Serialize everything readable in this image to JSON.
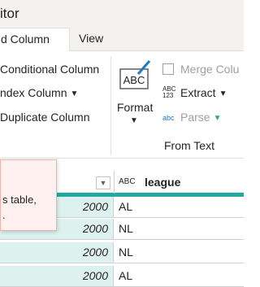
{
  "window": {
    "title": "itor"
  },
  "tabs": [
    {
      "label": "d Column",
      "active": true
    },
    {
      "label": "View",
      "active": false
    }
  ],
  "ribbon": {
    "left_items": [
      {
        "label": "Conditional Column"
      },
      {
        "label": "ndex Column"
      },
      {
        "label": "Duplicate Column"
      }
    ],
    "format": {
      "icon_text": "ABC",
      "label": "Format"
    },
    "text_items": [
      {
        "label": "Merge Colu",
        "disabled": true
      },
      {
        "label": "Extract",
        "disabled": false
      },
      {
        "label": "Parse",
        "disabled": true
      }
    ],
    "group_label": "From Text",
    "accent_color": "#22a9a2"
  },
  "tooltip": {
    "line1": "s table,",
    "line2": "."
  },
  "grid": {
    "column2": {
      "type_icon": "ABC",
      "header": "league"
    },
    "rows": [
      {
        "year": "2000",
        "league": "AL"
      },
      {
        "year": "2000",
        "league": "NL"
      },
      {
        "year": "2000",
        "league": "NL"
      },
      {
        "year": "2000",
        "league": "AL"
      }
    ]
  }
}
